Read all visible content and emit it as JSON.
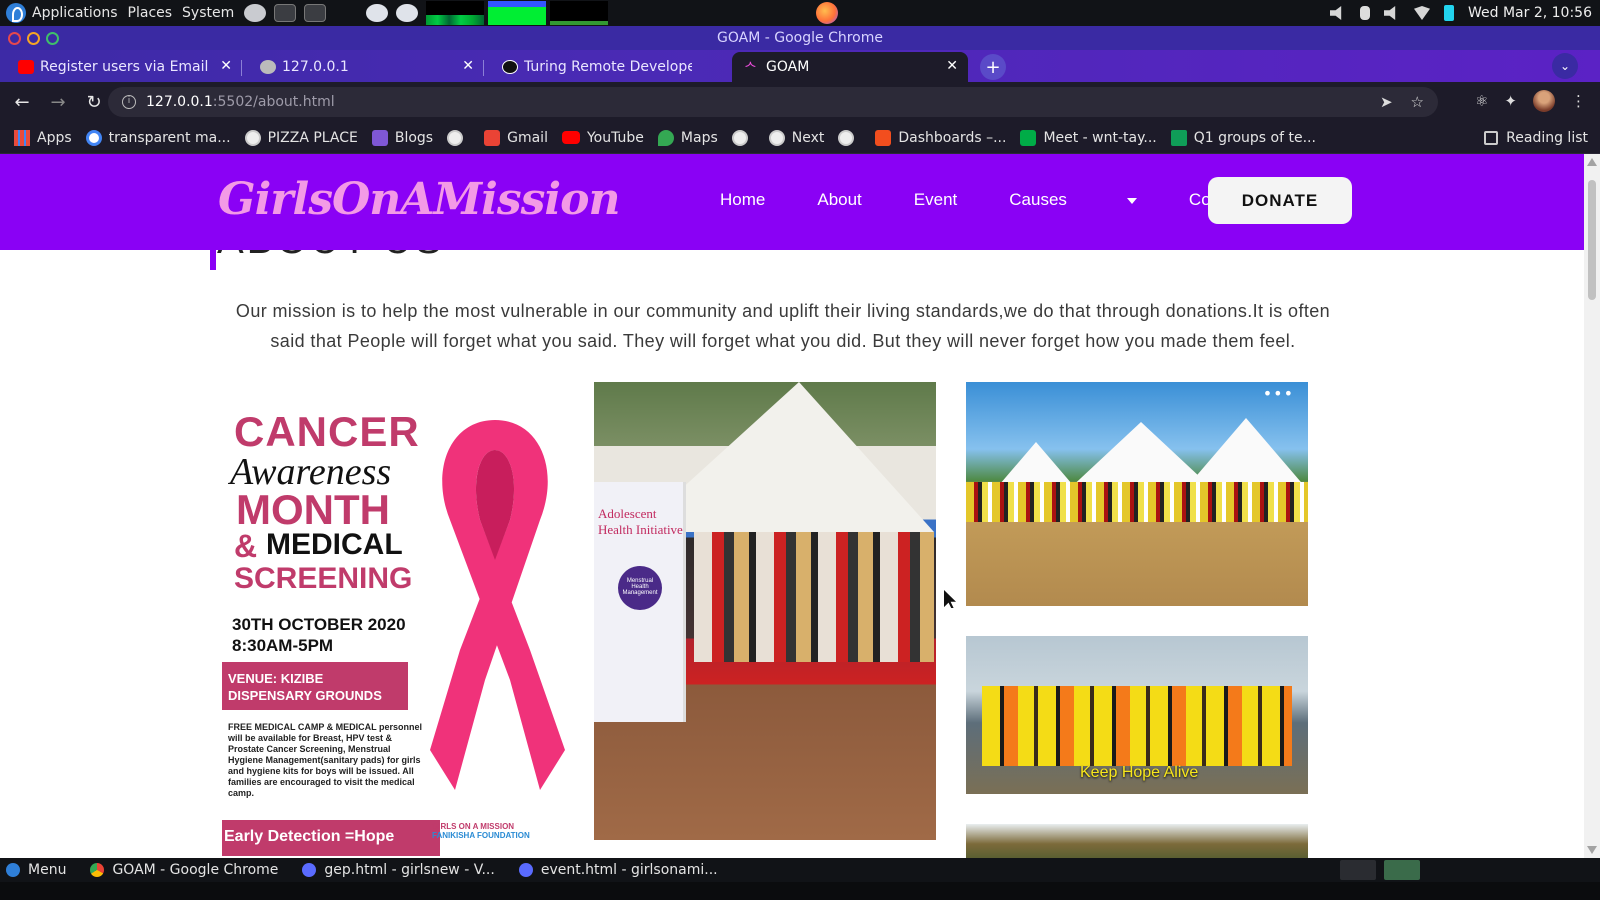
{
  "system_panel": {
    "menus": [
      "Applications",
      "Places",
      "System"
    ],
    "clock": "Wed Mar 2, 10:56"
  },
  "window": {
    "title": "GOAM - Google Chrome"
  },
  "tabs": [
    {
      "label": "Register users via Email/ S",
      "icon": "youtube-icon"
    },
    {
      "label": "127.0.0.1",
      "icon": "globe-icon"
    },
    {
      "label": "Turing Remote Developer",
      "icon": "turing-icon"
    },
    {
      "label": "GOAM",
      "icon": "ribbon-icon",
      "active": true
    }
  ],
  "toolbar": {
    "url_host": "127.0.0.1",
    "url_rest": ":5502/about.html"
  },
  "bookmarks": [
    {
      "label": "Apps",
      "icon": "apps-icon"
    },
    {
      "label": "transparent ma...",
      "icon": "google-icon"
    },
    {
      "label": "PIZZA PLACE",
      "icon": "globe-icon"
    },
    {
      "label": "Blogs",
      "icon": "blog-icon"
    },
    {
      "label": "",
      "icon": "globe-icon"
    },
    {
      "label": "Gmail",
      "icon": "gmail-icon"
    },
    {
      "label": "YouTube",
      "icon": "youtube-icon"
    },
    {
      "label": "Maps",
      "icon": "maps-icon"
    },
    {
      "label": "",
      "icon": "globe-icon"
    },
    {
      "label": "Next",
      "icon": "globe-icon"
    },
    {
      "label": "",
      "icon": "globe-icon"
    },
    {
      "label": "Dashboards –...",
      "icon": "figma-icon"
    },
    {
      "label": "Meet - wnt-tay...",
      "icon": "meet-icon"
    },
    {
      "label": "Q1 groups of te...",
      "icon": "sheets-icon"
    }
  ],
  "reading_list": "Reading list",
  "site": {
    "brand": "GirlsOnAMission",
    "nav": [
      "Home",
      "About",
      "Event",
      "Causes",
      "Contact"
    ],
    "donate": "DONATE",
    "heading": "ABOUT US",
    "mission": "Our mission is to help the most vulnerable in our community and uplift their living standards,we do that through donations.It is often said that People will forget what you said. They will forget what you did. But they will never forget how you made them feel.",
    "accent_color": "#8a01f5",
    "brand_color": "#f39ae6"
  },
  "poster": {
    "line1": "CANCER",
    "line2": "Awareness",
    "line3": "MONTH",
    "amp": "&",
    "line4": "MEDICAL",
    "line5": "SCREENING",
    "date": "30TH OCTOBER 2020",
    "time": "8:30AM-5PM",
    "venue": "VENUE: KIZIBE DISPENSARY GROUNDS",
    "details": "FREE MEDICAL CAMP & MEDICAL personnel will be available for Breast, HPV test & Prostate Cancer Screening, Menstrual Hygiene Management(sanitary pads) for girls and hygiene kits for boys will be issued. All families are encouraged to visit the medical camp.",
    "footer": "Early Detection =Hope",
    "logo1": "GIRLS ON A MISSION",
    "logo2": "FANIKISHA FOUNDATION"
  },
  "photos": {
    "banner_title": "Adolescent Health Initiative",
    "banner_circle": "Menstrual Health Management",
    "caption": "Keep Hope Alive"
  },
  "taskbar": [
    {
      "label": "Menu",
      "icon": "menu-icon"
    },
    {
      "label": "GOAM - Google Chrome",
      "icon": "chrome-icon"
    },
    {
      "label": "gep.html - girlsnew - V...",
      "icon": "vscode-icon"
    },
    {
      "label": "event.html - girlsonami...",
      "icon": "vscode-icon"
    }
  ]
}
